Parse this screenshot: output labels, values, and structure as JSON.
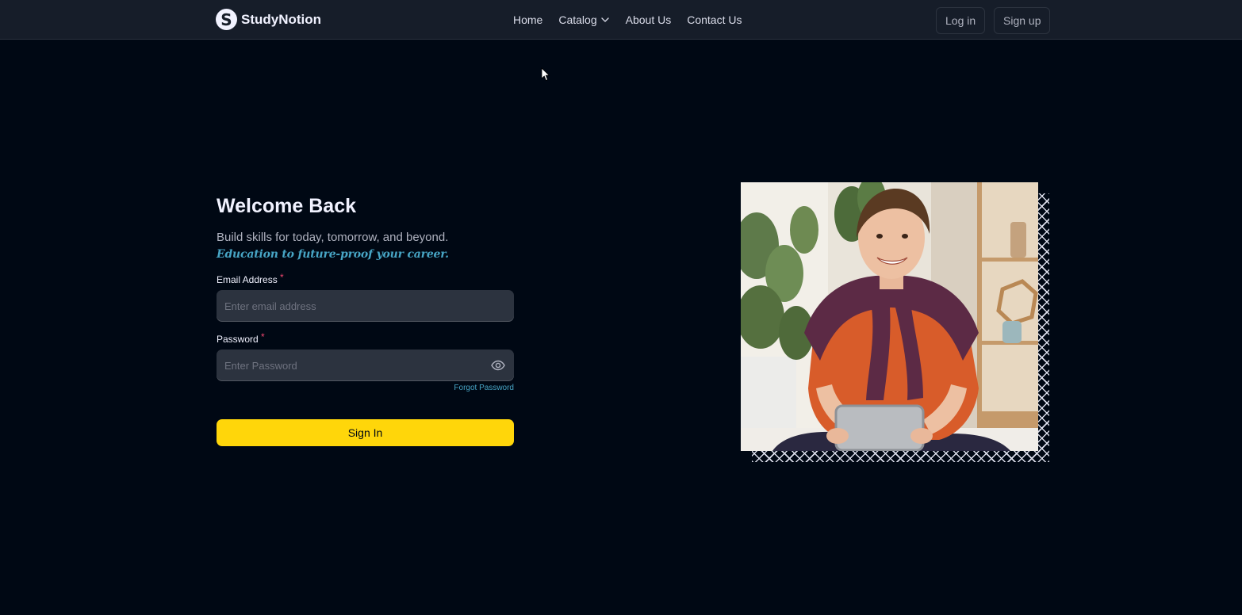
{
  "navbar": {
    "brand": "StudyNotion",
    "links": [
      "Home",
      "Catalog",
      "About Us",
      "Contact Us"
    ],
    "login_label": "Log in",
    "signup_label": "Sign up"
  },
  "login": {
    "title": "Welcome Back",
    "subtitle": "Build skills for today, tomorrow, and beyond.",
    "tagline": "Education to future-proof your career.",
    "email_label": "Email Address",
    "email_placeholder": "Enter email address",
    "password_label": "Password",
    "password_placeholder": "Enter Password",
    "forgot_label": "Forgot Password",
    "submit_label": "Sign In",
    "required_mark": "*"
  },
  "colors": {
    "background": "#000814",
    "navbar": "#161D29",
    "accent_yellow": "#FFD60A",
    "accent_blue": "#47A5C5",
    "required_pink": "#EF476F",
    "input_bg": "#2C333F"
  },
  "icons": {
    "brand": "studynotion-logo-icon",
    "catalog_dropdown": "chevron-down-icon",
    "password_toggle": "eye-icon",
    "pointer": "mouse-cursor-icon"
  }
}
